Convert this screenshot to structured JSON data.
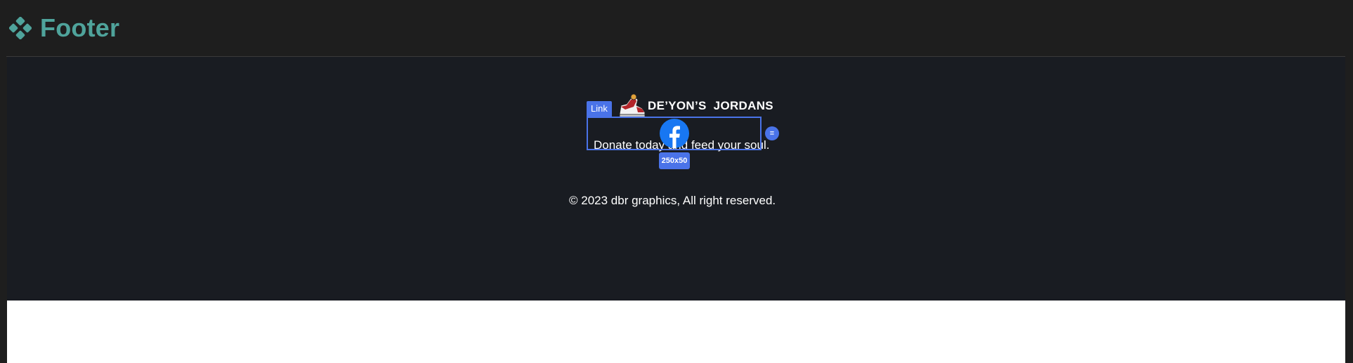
{
  "header": {
    "title": "Footer",
    "icon": "component-icon",
    "accent_color": "#4fa39b"
  },
  "footer": {
    "logo_text": "DE’YON’S  JORDANS",
    "logo_icon": "sneaker-icon",
    "tagline": "Donate today and feed your soul.",
    "link_badge": "Link",
    "social_icon": "facebook-icon",
    "size_badge": "250x50",
    "menu_handle_symbol": "≡",
    "copyright": "© 2023 dbr graphics, All right reserved.",
    "background": "#191c22",
    "selection_color": "#4a73e8"
  }
}
